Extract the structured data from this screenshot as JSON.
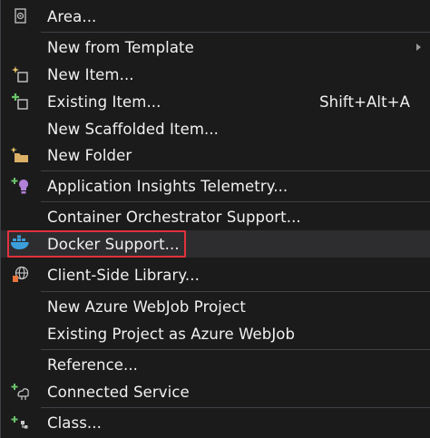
{
  "menu": {
    "items": [
      {
        "label": "Area...",
        "icon": "area-icon"
      },
      {
        "label": "New from Template",
        "submenu": true
      },
      {
        "label": "New Item...",
        "icon": "new-item-icon"
      },
      {
        "label": "Existing Item...",
        "icon": "existing-item-icon",
        "shortcut": "Shift+Alt+A"
      },
      {
        "label": "New Scaffolded Item..."
      },
      {
        "label": "New Folder",
        "icon": "new-folder-icon"
      },
      {
        "label": "Application Insights Telemetry...",
        "icon": "app-insights-icon"
      },
      {
        "label": "Container Orchestrator Support..."
      },
      {
        "label": "Docker Support...",
        "icon": "docker-icon"
      },
      {
        "label": "Client-Side Library...",
        "icon": "client-library-icon"
      },
      {
        "label": "New Azure WebJob Project"
      },
      {
        "label": "Existing Project as Azure WebJob"
      },
      {
        "label": "Reference..."
      },
      {
        "label": "Connected Service",
        "icon": "connected-service-icon"
      },
      {
        "label": "Class...",
        "icon": "class-icon"
      }
    ]
  },
  "colors": {
    "background": "#1b1b1c",
    "highlight": "#2d2d30",
    "highlight_outline": "#e0313b",
    "separator": "#3f3f46",
    "text": "#f1f1f1"
  }
}
